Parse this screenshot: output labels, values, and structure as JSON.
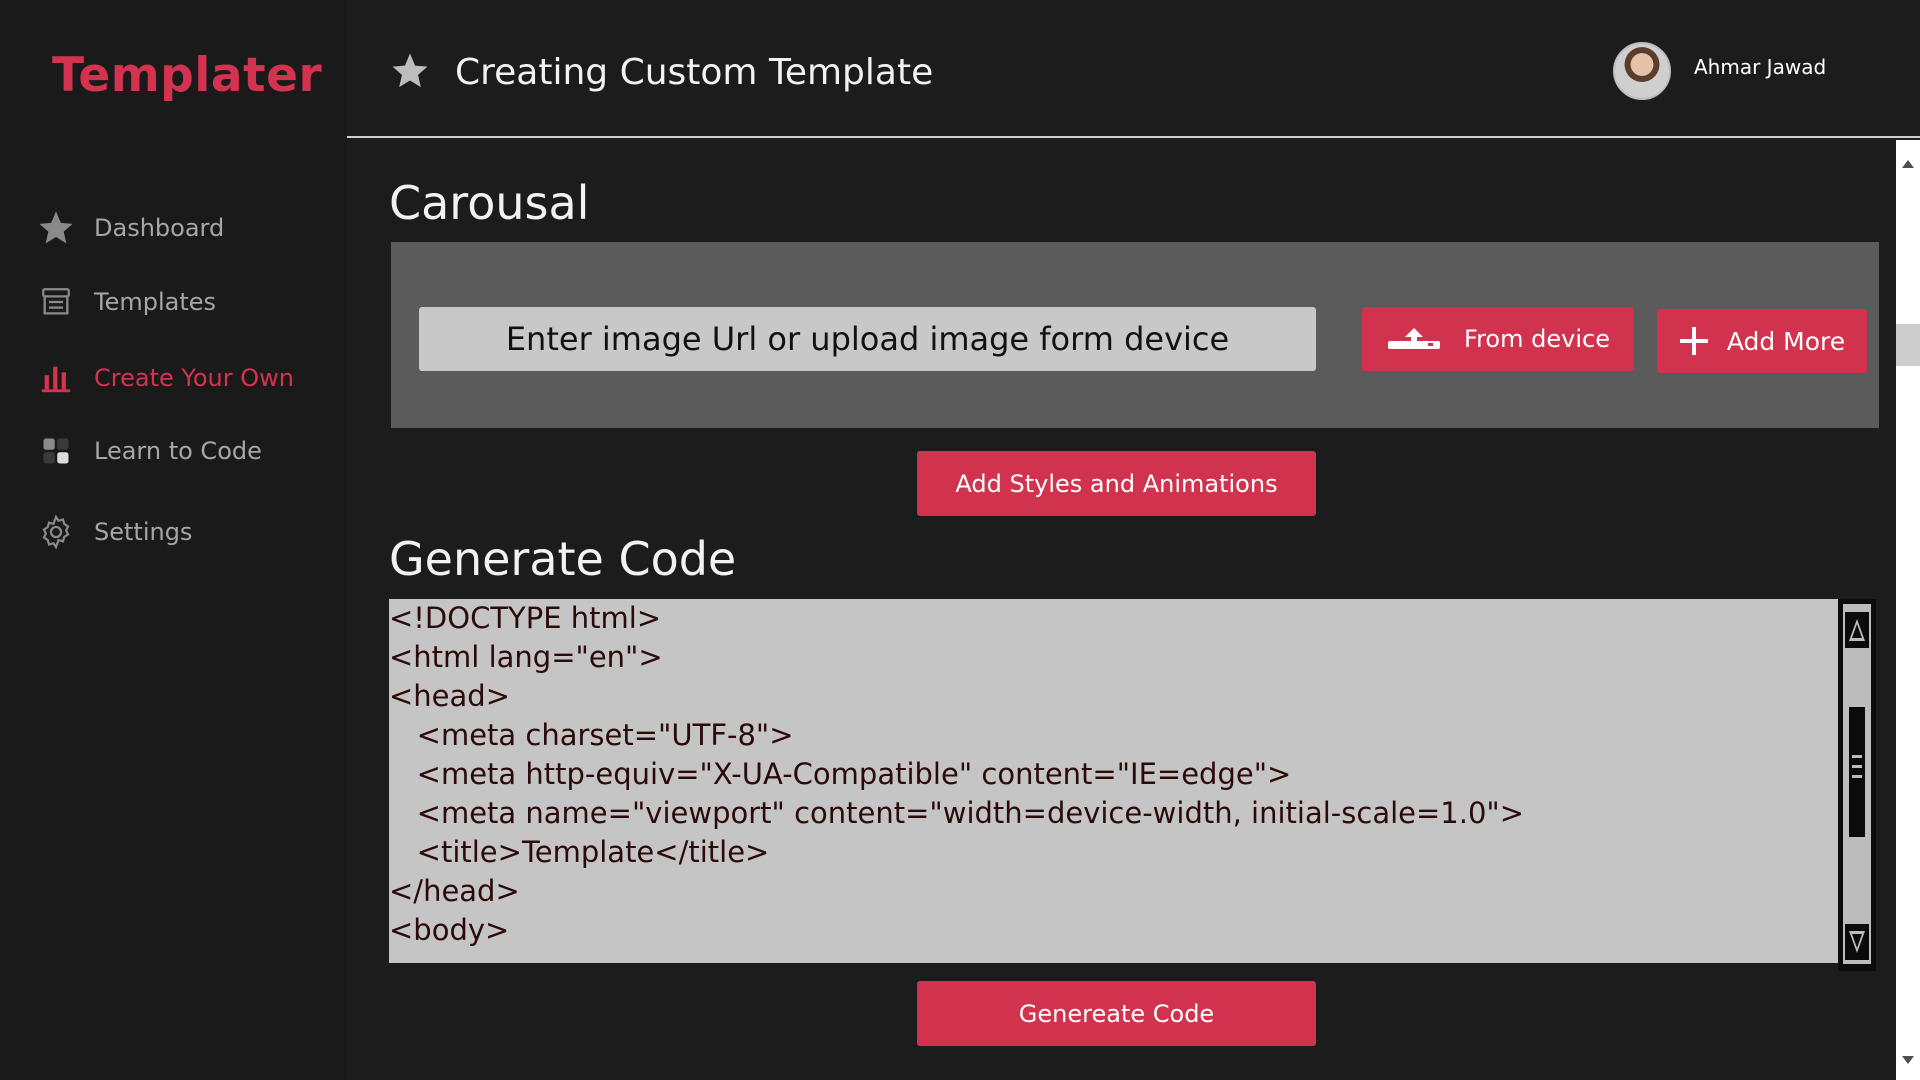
{
  "app": {
    "logo": "Templater",
    "accent_color": "#d4334f"
  },
  "sidebar": {
    "items": [
      {
        "label": "Dashboard",
        "icon": "star-icon",
        "active": false
      },
      {
        "label": "Templates",
        "icon": "store-icon",
        "active": false
      },
      {
        "label": "Create Your Own",
        "icon": "bar-chart-icon",
        "active": true
      },
      {
        "label": "Learn to Code",
        "icon": "blocks-icon",
        "active": false
      },
      {
        "label": "Settings",
        "icon": "gear-icon",
        "active": false
      }
    ]
  },
  "header": {
    "title": "Creating Custom Template",
    "title_icon": "star-icon",
    "user_name": "Ahmar Jawad"
  },
  "carousel": {
    "section_title": "Carousal",
    "input_placeholder": "Enter image Url or upload image form device",
    "from_device_label": "From device",
    "add_more_label": "Add More"
  },
  "styles_button_label": "Add Styles and Animations",
  "generate": {
    "section_title": "Generate Code",
    "code": "<!DOCTYPE html>\n<html lang=\"en\">\n<head>\n   <meta charset=\"UTF-8\">\n   <meta http-equiv=\"X-UA-Compatible\" content=\"IE=edge\">\n   <meta name=\"viewport\" content=\"width=device-width, initial-scale=1.0\">\n   <title>Template</title>\n</head>\n<body>",
    "button_label": "Genereate Code"
  }
}
